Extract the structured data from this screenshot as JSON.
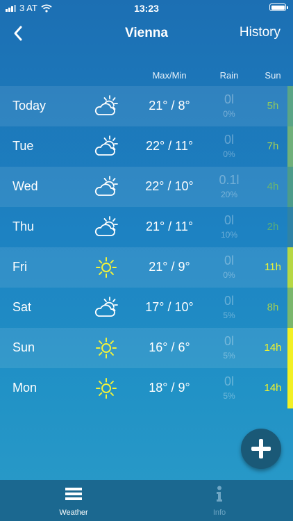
{
  "status_bar": {
    "carrier": "3 AT",
    "time": "13:23"
  },
  "nav": {
    "title": "Vienna",
    "history_label": "History"
  },
  "columns": {
    "maxmin": "Max/Min",
    "rain": "Rain",
    "sun": "Sun"
  },
  "days": [
    {
      "day": "Today",
      "icon": "partly-cloudy-icon",
      "temp": "21° / 8°",
      "rain": "0l",
      "rain_pct": "0%",
      "sun": "5h",
      "sun_color": "#8fc95e",
      "bar_color": "#5aa586"
    },
    {
      "day": "Tue",
      "icon": "partly-cloudy-icon",
      "temp": "22° / 11°",
      "rain": "0l",
      "rain_pct": "0%",
      "sun": "7h",
      "sun_color": "#a6d052",
      "bar_color": "#6fb07a"
    },
    {
      "day": "Wed",
      "icon": "partly-cloudy-icon",
      "temp": "22° / 10°",
      "rain": "0.1l",
      "rain_pct": "20%",
      "sun": "4h",
      "sun_color": "#6fb86a",
      "bar_color": "#4c9c8a"
    },
    {
      "day": "Thu",
      "icon": "partly-cloudy-icon",
      "temp": "21° / 11°",
      "rain": "0l",
      "rain_pct": "10%",
      "sun": "2h",
      "sun_color": "#5aae78",
      "bar_color": "#2f83a6"
    },
    {
      "day": "Fri",
      "icon": "sun-icon",
      "temp": "21° / 9°",
      "rain": "0l",
      "rain_pct": "0%",
      "sun": "11h",
      "sun_color": "#e8f238",
      "bar_color": "#b6d844"
    },
    {
      "day": "Sat",
      "icon": "partly-cloudy-icon",
      "temp": "17° / 10°",
      "rain": "0l",
      "rain_pct": "5%",
      "sun": "8h",
      "sun_color": "#a6d052",
      "bar_color": "#7ab76c"
    },
    {
      "day": "Sun",
      "icon": "sun-icon",
      "temp": "16° / 6°",
      "rain": "0l",
      "rain_pct": "5%",
      "sun": "14h",
      "sun_color": "#f5f526",
      "bar_color": "#f2f024"
    },
    {
      "day": "Mon",
      "icon": "sun-icon",
      "temp": "18° / 9°",
      "rain": "0l",
      "rain_pct": "5%",
      "sun": "14h",
      "sun_color": "#f5f526",
      "bar_color": "#f2f024"
    }
  ],
  "fab": {
    "icon": "plus-icon"
  },
  "tabs": [
    {
      "label": "Weather",
      "icon": "list-icon",
      "color": "#ffffff"
    },
    {
      "label": "Info",
      "icon": "info-icon",
      "color": "#6fa6c4"
    }
  ]
}
